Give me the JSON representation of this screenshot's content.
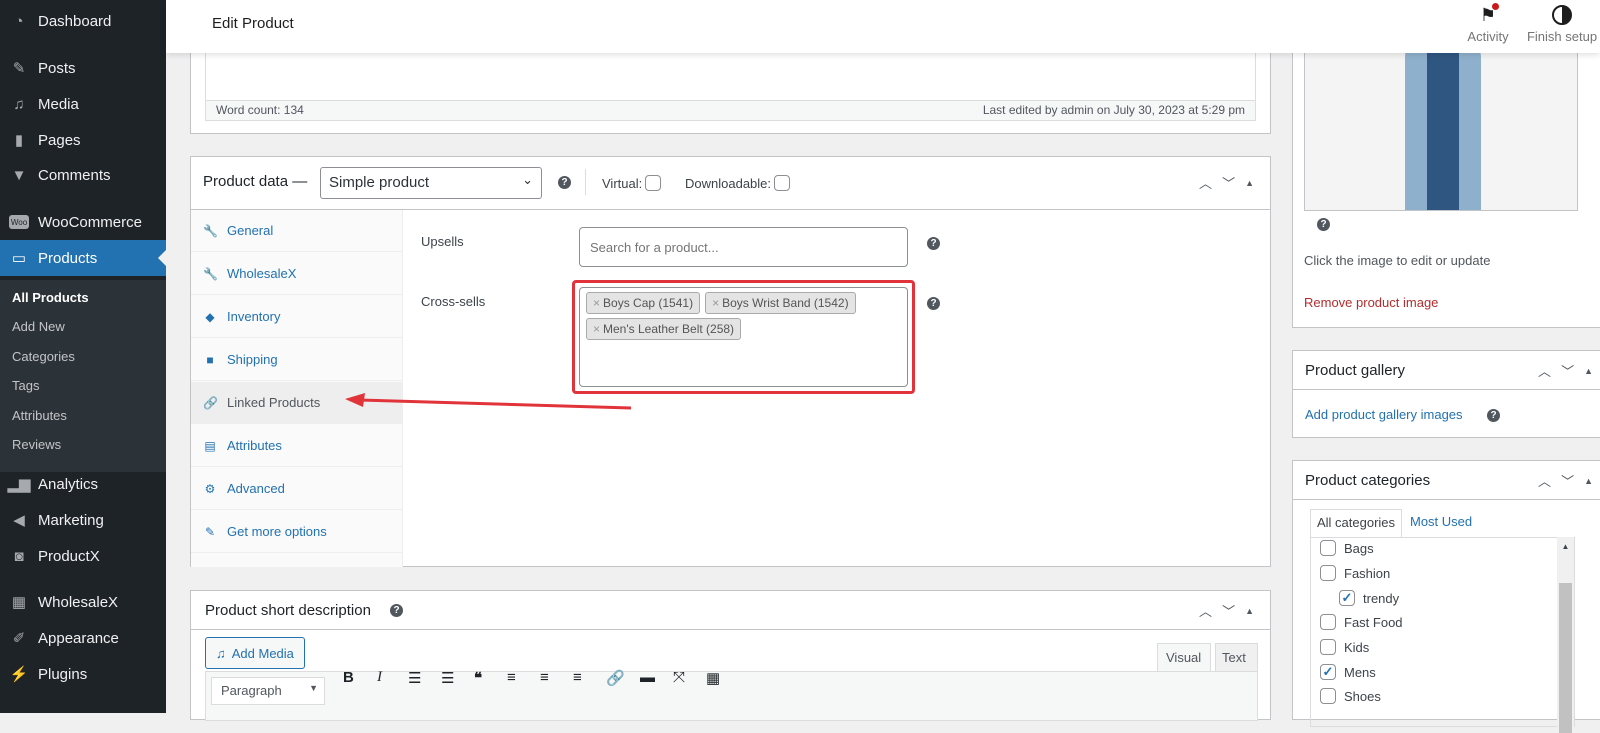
{
  "sidebar": {
    "items": [
      {
        "label": "Dashboard",
        "icon": "dashboard-icon"
      },
      {
        "label": "Posts",
        "icon": "pin-icon"
      },
      {
        "label": "Media",
        "icon": "media-icon"
      },
      {
        "label": "Pages",
        "icon": "pages-icon"
      },
      {
        "label": "Comments",
        "icon": "comment-icon"
      },
      {
        "label": "WooCommerce",
        "icon": "woo-icon"
      },
      {
        "label": "Products",
        "icon": "archive-icon"
      },
      {
        "label": "Analytics",
        "icon": "bar-chart-icon"
      },
      {
        "label": "Marketing",
        "icon": "megaphone-icon"
      },
      {
        "label": "ProductX",
        "icon": "bag-icon"
      },
      {
        "label": "WholesaleX",
        "icon": "cart-icon"
      },
      {
        "label": "Appearance",
        "icon": "brush-icon"
      },
      {
        "label": "Plugins",
        "icon": "plug-icon"
      }
    ],
    "submenu": [
      "All Products",
      "Add New",
      "Categories",
      "Tags",
      "Attributes",
      "Reviews"
    ]
  },
  "header": {
    "title": "Edit Product",
    "activity": "Activity",
    "finish_setup": "Finish setup"
  },
  "editor": {
    "word_count": "Word count: 134",
    "last_edited": "Last edited by admin on July 30, 2023 at 5:29 pm"
  },
  "product_data": {
    "title": "Product data —",
    "type_value": "Simple product",
    "virtual_label": "Virtual:",
    "downloadable_label": "Downloadable:",
    "tabs": [
      {
        "label": "General",
        "icon": "wrench-icon"
      },
      {
        "label": "WholesaleX",
        "icon": "wrench-icon"
      },
      {
        "label": "Inventory",
        "icon": "tag-icon"
      },
      {
        "label": "Shipping",
        "icon": "truck-icon"
      },
      {
        "label": "Linked Products",
        "icon": "link-icon"
      },
      {
        "label": "Attributes",
        "icon": "list-icon"
      },
      {
        "label": "Advanced",
        "icon": "gear-icon"
      },
      {
        "label": "Get more options",
        "icon": "plugin-icon"
      }
    ],
    "upsells_label": "Upsells",
    "upsells_placeholder": "Search for a product...",
    "crosssells_label": "Cross-sells",
    "crosssells": [
      "Boys Cap (1541)",
      "Boys Wrist Band (1542)",
      "Men's Leather Belt (258)"
    ]
  },
  "short_desc": {
    "title": "Product short description",
    "add_media": "Add Media",
    "visual": "Visual",
    "text": "Text",
    "format": "Paragraph"
  },
  "product_image": {
    "hint": "Click the image to edit or update",
    "remove": "Remove product image"
  },
  "gallery": {
    "title": "Product gallery",
    "add": "Add product gallery images"
  },
  "categories": {
    "title": "Product categories",
    "tab_all": "All categories",
    "tab_used": "Most Used",
    "items": [
      {
        "label": "Bags",
        "checked": false
      },
      {
        "label": "Fashion",
        "checked": false
      },
      {
        "label": "trendy",
        "checked": true,
        "child": true
      },
      {
        "label": "Fast Food",
        "checked": false
      },
      {
        "label": "Kids",
        "checked": false
      },
      {
        "label": "Mens",
        "checked": true
      },
      {
        "label": "Shoes",
        "checked": false
      }
    ]
  },
  "colors": {
    "accent": "#2271b1",
    "highlight": "#e0343a"
  }
}
